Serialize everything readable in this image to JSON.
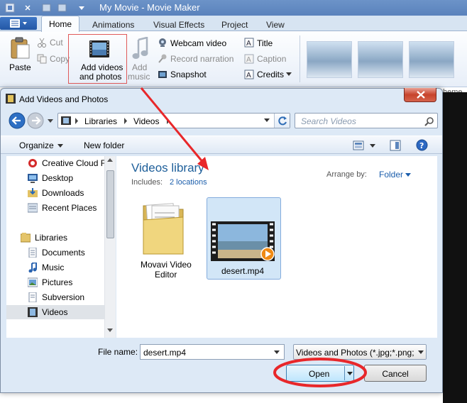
{
  "app": {
    "title": "My Movie - Movie Maker",
    "tabs": [
      "Home",
      "Animations",
      "Visual Effects",
      "Project",
      "View"
    ],
    "ribbon": {
      "paste": "Paste",
      "cut": "Cut",
      "copy": "Copy",
      "add_videos_line1": "Add videos",
      "add_videos_line2": "and photos",
      "add_music_line1": "Add",
      "add_music_line2": "music",
      "webcam_video": "Webcam video",
      "record_narration": "Record narration",
      "snapshot": "Snapshot",
      "title": "Title",
      "caption": "Caption",
      "credits": "Credits",
      "themes_partial": "heme"
    }
  },
  "dialog": {
    "title": "Add Videos and Photos",
    "breadcrumb": [
      "Libraries",
      "Videos"
    ],
    "search_placeholder": "Search Videos",
    "toolbar": {
      "organize": "Organize",
      "new_folder": "New folder"
    },
    "nav_pane": {
      "favorites": [
        "Creative Cloud F",
        "Desktop",
        "Downloads",
        "Recent Places"
      ],
      "libraries_label": "Libraries",
      "libraries": [
        "Documents",
        "Music",
        "Pictures",
        "Subversion",
        "Videos"
      ]
    },
    "library": {
      "title": "Videos library",
      "includes_label": "Includes:",
      "locations_link": "2 locations",
      "arrange_label": "Arrange by:",
      "arrange_value": "Folder"
    },
    "files": [
      {
        "name_line1": "Movavi Video",
        "name_line2": "Editor",
        "type": "folder"
      },
      {
        "name_line1": "desert.mp4",
        "name_line2": "",
        "type": "video"
      }
    ],
    "file_name_label": "File name:",
    "file_name_value": "desert.mp4",
    "file_type_value": "Videos and Photos (*.jpg;*.png;",
    "open_label": "Open",
    "cancel_label": "Cancel"
  },
  "annotation_color": "#e8272a"
}
